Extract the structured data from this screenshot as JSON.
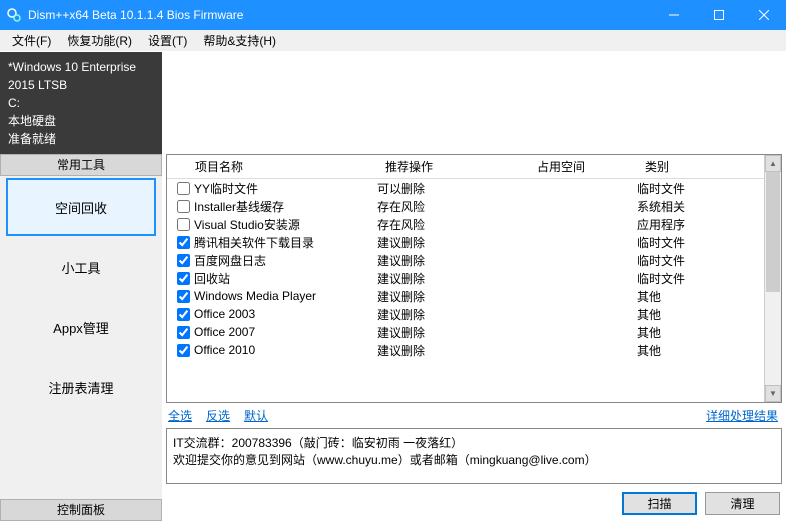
{
  "titlebar": {
    "title": "Dism++x64 Beta 10.1.1.4 Bios Firmware"
  },
  "menubar": {
    "file": "文件(F)",
    "recovery": "恢复功能(R)",
    "settings": "设置(T)",
    "help": "帮助&支持(H)"
  },
  "info": {
    "line1": "*Windows 10 Enterprise 2015 LTSB",
    "line2": "C:",
    "line3": "本地硬盘",
    "line4": "准备就绪"
  },
  "sidebar": {
    "header": "常用工具",
    "items": [
      {
        "label": "空间回收",
        "active": true
      },
      {
        "label": "小工具",
        "active": false
      },
      {
        "label": "Appx管理",
        "active": false
      },
      {
        "label": "注册表清理",
        "active": false
      }
    ],
    "footer": "控制面板"
  },
  "table": {
    "columns": {
      "name": "项目名称",
      "action": "推荐操作",
      "space": "占用空间",
      "category": "类别"
    },
    "rows": [
      {
        "checked": false,
        "name": "YY临时文件",
        "action": "可以删除",
        "space": "",
        "category": "临时文件"
      },
      {
        "checked": false,
        "name": "Installer基线缓存",
        "action": "存在风险",
        "space": "",
        "category": "系统相关"
      },
      {
        "checked": false,
        "name": "Visual Studio安装源",
        "action": "存在风险",
        "space": "",
        "category": "应用程序"
      },
      {
        "checked": true,
        "name": "腾讯相关软件下载目录",
        "action": "建议删除",
        "space": "",
        "category": "临时文件"
      },
      {
        "checked": true,
        "name": "百度网盘日志",
        "action": "建议删除",
        "space": "",
        "category": "临时文件"
      },
      {
        "checked": true,
        "name": "回收站",
        "action": "建议删除",
        "space": "",
        "category": "临时文件"
      },
      {
        "checked": true,
        "name": "Windows Media Player",
        "action": "建议删除",
        "space": "",
        "category": "其他"
      },
      {
        "checked": true,
        "name": "Office 2003",
        "action": "建议删除",
        "space": "",
        "category": "其他"
      },
      {
        "checked": true,
        "name": "Office 2007",
        "action": "建议删除",
        "space": "",
        "category": "其他"
      },
      {
        "checked": true,
        "name": "Office 2010",
        "action": "建议删除",
        "space": "",
        "category": "其他"
      }
    ]
  },
  "links": {
    "selectAll": "全选",
    "invert": "反选",
    "default": "默认",
    "detail": "详细处理结果"
  },
  "infoText": {
    "line1": "IT交流群：200783396（敲门砖：临安初雨 一夜落红）",
    "line2": "欢迎提交你的意见到网站（www.chuyu.me）或者邮箱（mingkuang@live.com）"
  },
  "buttons": {
    "scan": "扫描",
    "clean": "清理"
  }
}
